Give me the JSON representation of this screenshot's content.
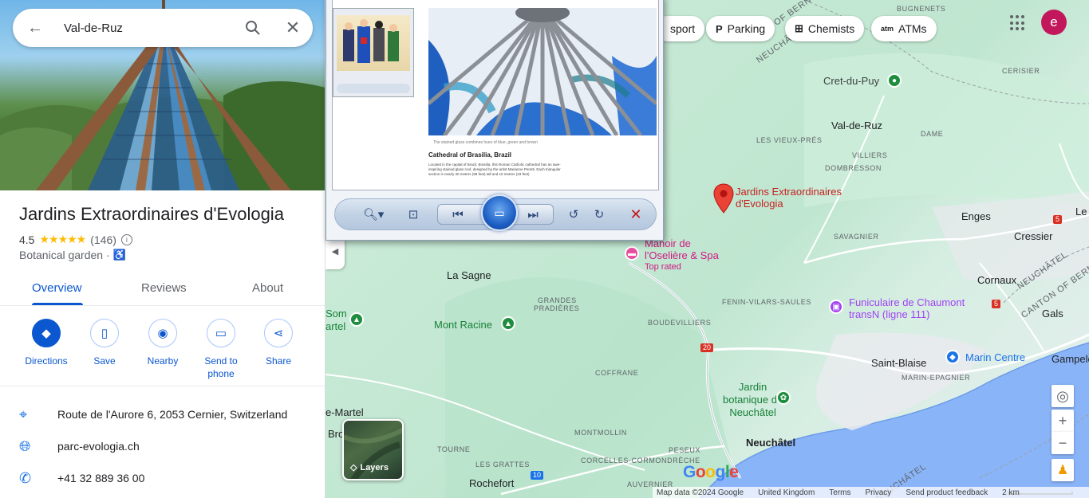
{
  "search": {
    "query": "Val-de-Ruz"
  },
  "place": {
    "title": "Jardins Extraordinaires d'Evologia",
    "rating": "4.5",
    "stars": "★★★★★",
    "review_count": "(146)",
    "category": "Botanical garden ·",
    "accessibility_icon": "♿"
  },
  "tabs": [
    {
      "label": "Overview"
    },
    {
      "label": "Reviews"
    },
    {
      "label": "About"
    }
  ],
  "actions": [
    {
      "label": "Directions",
      "icon": "directions-icon"
    },
    {
      "label": "Save",
      "icon": "bookmark-icon"
    },
    {
      "label": "Nearby",
      "icon": "nearby-icon"
    },
    {
      "label": "Send to",
      "label2": "phone",
      "icon": "send-to-phone-icon"
    },
    {
      "label": "Share",
      "icon": "share-icon"
    }
  ],
  "details": {
    "address": "Route de l'Aurore 6, 2053 Cernier, Switzerland",
    "website": "parc-evologia.ch",
    "phone": "+41 32 889 36 00"
  },
  "chips": [
    {
      "label": "sport"
    },
    {
      "label": "Parking",
      "icon": "P"
    },
    {
      "label": "Chemists"
    },
    {
      "label": "ATMs"
    }
  ],
  "account": {
    "initial": "e",
    "color": "#c2185b"
  },
  "map": {
    "labels": {
      "of_bern": "OF BERN",
      "bugnenets": "BUGNENETS",
      "neuchatel_rot": "NEUCHÂTEL",
      "cerisier": "CERISIER",
      "cret_du_puy": "Cret-du-Puy",
      "val_de_ruz": "Val-de-Ruz",
      "dame": "DAME",
      "les_vieux_pres": "LES VIEUX-PRÉS",
      "villiers": "VILLIERS",
      "dombresson": "DOMBRESSON",
      "engés": "Enges",
      "le": "Le",
      "cressier": "Cressier",
      "savagnier": "SAVAGNIER",
      "manoir": "Manoir de",
      "manoir2": "l'Oselière & Spa",
      "top_rated": "Top rated",
      "la_sagne": "La Sagne",
      "cornaux": "Cornaux",
      "neuchatel2": "NEUCHÂTEL",
      "canton_of_bern": "CANTON OF BERN",
      "grandes": "GRANDES",
      "pradieres": "PRADIÈRES",
      "fenin": "FENIN-VILARS-SAULES",
      "funiculaire": "Funiculaire de Chaumont",
      "transn": "transN (ligne 111)",
      "gals": "Gals",
      "som": "Som",
      "artel": "artel",
      "mont_racine": "Mont Racine",
      "boudevilliers": "BOUDEVILLIERS",
      "saint_blaise": "Saint-Blaise",
      "marin_centre": "Marin Centre",
      "gampele": "Gampele",
      "marin_epagnier": "MARIN-EPAGNIER",
      "coffrane": "COFFRANE",
      "jardin": "Jardin",
      "botanique": "botanique de",
      "neuchatel_jardin": "Neuchâtel",
      "de_martel": "e-Martel",
      "bro": "Bro",
      "montmollin": "MONTMOLLIN",
      "neuchatel_city": "Neuchâtel",
      "tourne": "TOURNE",
      "corcelles": "CORCELLES-CORMONDRÈCHE",
      "peseux": "PESEUX",
      "les_grattes": "LES GRATTES",
      "rochefort": "Rochefort",
      "auvernier": "AUVERNIER",
      "neuchatel_lake": "NEUCHÂTEL",
      "selected_place": "Jardins Extraordinaires",
      "selected_place2": "d'Evologia",
      "road20": "20",
      "road5a": "5",
      "road5b": "5",
      "road10": "10"
    },
    "layers_label": "Layers",
    "google": "Google",
    "attribution": [
      "Map data ©2024 Google",
      "United Kingdom",
      "Terms",
      "Privacy",
      "Send product feedback",
      "2 km"
    ]
  },
  "viewer": {
    "caption_title": "Cathedral of Brasilia, Brazil",
    "caption_small": "The stained glass combines hues of blue, green and brown",
    "caption_body": "Located in the capital of Brazil, Brasilia, this Roman Catholic cathedral has an awe-inspiring stained glass roof, designed by the artist Marianne Peretti. Each triangular section is nearly 30 metres (98 feet) tall and 10 metres (33 feet)"
  }
}
